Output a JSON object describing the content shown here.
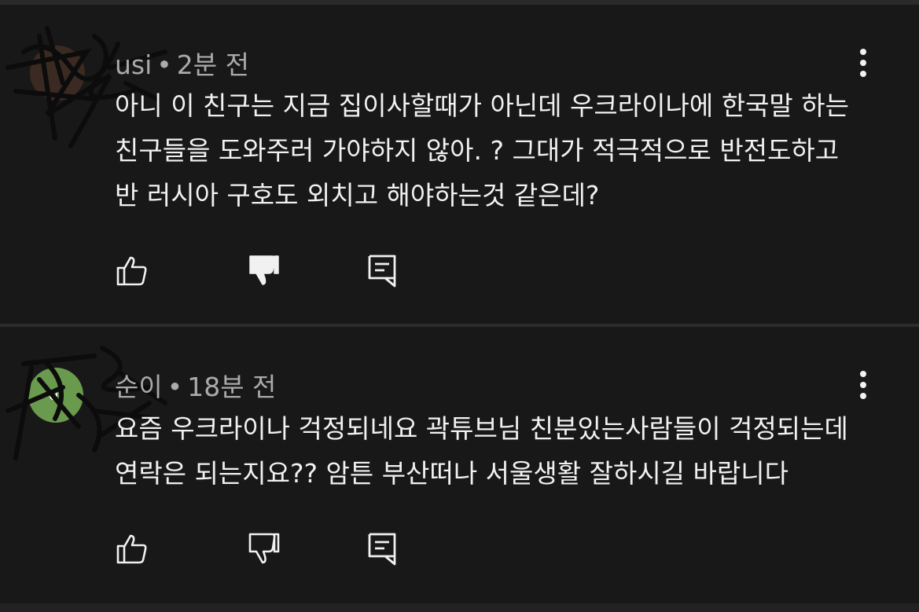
{
  "comments": [
    {
      "author": "usi",
      "avatar_initial": "",
      "avatar_color": "#3a2a22",
      "separator": "•",
      "time": "2분 전",
      "lines": [
        "아니 이 친구는 지금 집이사할때가 아닌데 우크라이나에 한국말 하는",
        "친구들을 도와주러 가야하지 않아. ? 그대가  적극적으로 반전도하고",
        "반 러시아 구호도 외치고 해야하는것 같은데?"
      ],
      "disliked": true
    },
    {
      "author": "순이",
      "avatar_initial": "이",
      "avatar_color": "#6a9a4e",
      "separator": "•",
      "time": "18분 전",
      "lines": [
        "요즘 우크라이나 걱정되네요 곽튜브님 친분있는사람들이 걱정되는데",
        "연락은 되는지요?? 암튼 부산떠나 서울생활 잘하시길 바랍니다"
      ],
      "disliked": false
    }
  ],
  "icons": {
    "like": "thumb-up-icon",
    "dislike": "thumb-down-icon",
    "reply": "reply-icon",
    "more": "more-vert-icon"
  },
  "colors": {
    "background": "#181818",
    "text": "#f1f1f1",
    "meta": "#aaaaaa"
  }
}
